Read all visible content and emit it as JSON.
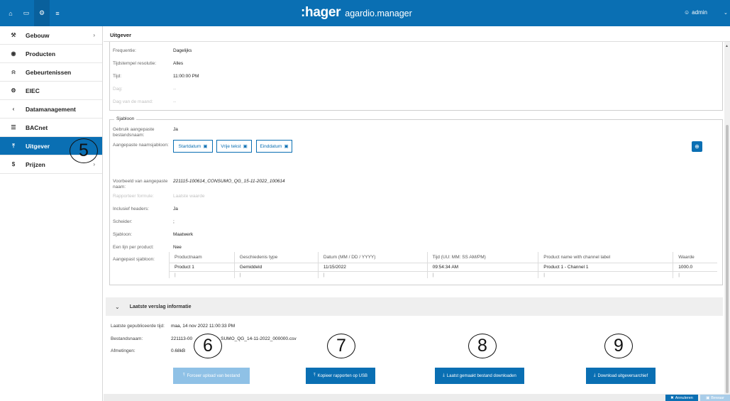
{
  "topbar": {
    "brand_logo": ":hager",
    "brand_product": "agardio.manager",
    "user": "admin",
    "nav_icons": [
      "home-icon",
      "laptop-icon",
      "cogs-icon",
      "sliders-icon"
    ]
  },
  "sidebar": {
    "items": [
      {
        "label": "Gebouw",
        "icon": "wrench-icon",
        "has_chevron": true
      },
      {
        "label": "Producten",
        "icon": "disc-icon",
        "has_chevron": false
      },
      {
        "label": "Gebeurtenissen",
        "icon": "bell-icon",
        "has_chevron": false
      },
      {
        "label": "EIEC",
        "icon": "cogs-icon",
        "has_chevron": false
      },
      {
        "label": "Datamanagement",
        "icon": "share-icon",
        "has_chevron": false
      },
      {
        "label": "BACnet",
        "icon": "server-icon",
        "has_chevron": false
      },
      {
        "label": "Uitgever",
        "icon": "upload-icon",
        "active": true
      },
      {
        "label": "Prijzen",
        "icon": "dollar-icon",
        "has_chevron": true
      }
    ],
    "callout": "5"
  },
  "main": {
    "title": "Uitgever",
    "schedule": {
      "frequentie_label": "Frequentie:",
      "frequentie_value": "Dagelijks",
      "resolutie_label": "Tijdstempel resolutie:",
      "resolutie_value": "Alles",
      "tijd_label": "Tijd:",
      "tijd_value": "11:00:00 PM",
      "dag_label": "Dag:",
      "dag_value": "--",
      "dagmaand_label": "Dag van de maand:",
      "dagmaand_value": "--"
    },
    "template": {
      "legend": "Sjabloon",
      "custom_filename_label": "Gebruik aangepaste bestandsnaam:",
      "custom_filename_value": "Ja",
      "name_template_label": "Aangepaste naamsjabloon:",
      "tags": [
        "Startdatum",
        "Vrije tekst",
        "Einddatum"
      ],
      "example_label": "Voorbeeld van aangepaste naam:",
      "example_value": "221115-100614_CONSUMO_QG_15-11-2022_100614",
      "formula_label": "Rapporteer formule:",
      "formula_value": "Laatste waarde",
      "headers_label": "Inclusief headers:",
      "headers_value": "Ja",
      "separator_label": "Scheider:",
      "separator_value": ";",
      "sjabloon_label": "Sjabloon:",
      "sjabloon_value": "Maatwerk",
      "per_product_label": "Een lijn per product:",
      "per_product_value": "Nee",
      "custom_template_label": "Aangepast sjabloon:",
      "columns": [
        "Productnaam",
        "Geschiedenis type",
        "Datum (MM / DD / YYYY)",
        "Tijd (UU: MM: SS AM/PM)",
        "Product name with channel label",
        "Waarde"
      ],
      "row": [
        "Product 1",
        "Gemiddeld",
        "11/15/2022",
        "09:54:34 AM",
        "Product 1 - Channel 1",
        "1000.0"
      ],
      "separators": [
        "|",
        "|",
        "|",
        "|",
        "|",
        "|"
      ]
    },
    "report": {
      "section_title": "Laatste verslag informatie",
      "published_label": "Laatste gepubliceerde tijd:",
      "published_value": "maa, 14 nov 2022 11:00:33 PM",
      "filename_label": "Bestandsnaam:",
      "filename_value_a": "221113-00",
      "filename_value_b": "SUMO_QG_14-11-2022_000000.csv",
      "size_label": "Afmetingen:",
      "size_value": "0.68kB"
    },
    "buttons": {
      "force_upload": "Forceer upload van bestand",
      "copy_usb": "Kopieer rapporten op USB",
      "download_last": "Laatst gemaakt bestand downloaden",
      "download_archive": "Download uitgeversarchief"
    },
    "callouts": [
      "6",
      "7",
      "8",
      "9"
    ],
    "footer": {
      "cancel": "Annuleren",
      "save": "Bewaar"
    }
  },
  "colors": {
    "primary": "#0a6fb3",
    "disabled": "#8fc1e6"
  }
}
